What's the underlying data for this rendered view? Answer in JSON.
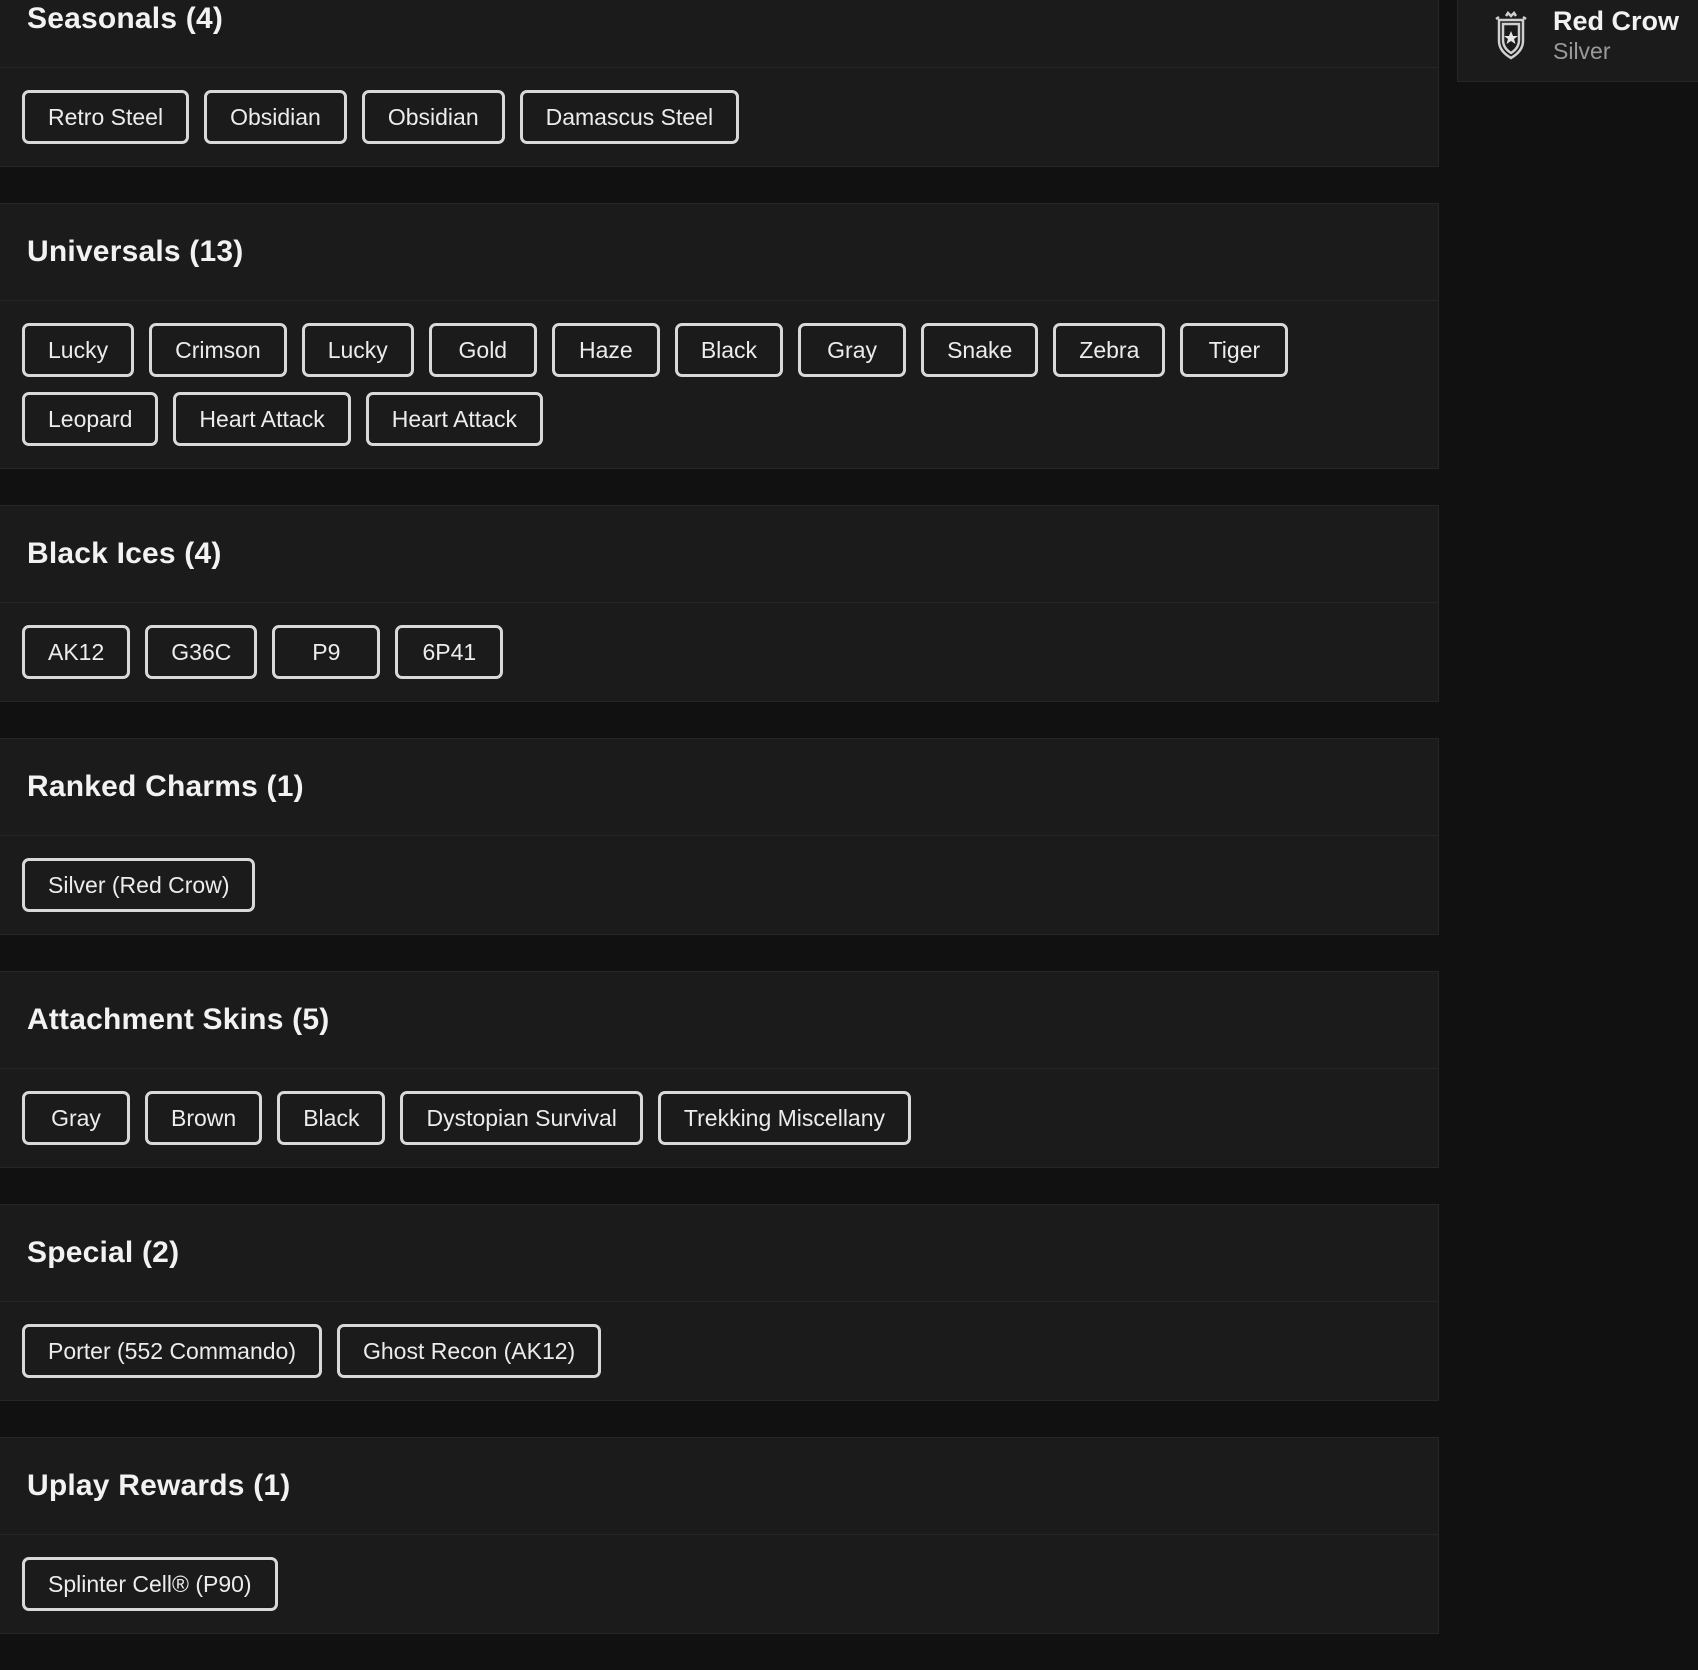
{
  "sections": [
    {
      "title": "Seasonals (4)",
      "items": [
        "Retro Steel",
        "Obsidian",
        "Obsidian",
        "Damascus Steel"
      ]
    },
    {
      "title": "Universals (13)",
      "items": [
        "Lucky",
        "Crimson",
        "Lucky",
        "Gold",
        "Haze",
        "Black",
        "Gray",
        "Snake",
        "Zebra",
        "Tiger",
        "Leopard",
        "Heart Attack",
        "Heart Attack"
      ]
    },
    {
      "title": "Black Ices (4)",
      "items": [
        "AK12",
        "G36C",
        "P9",
        "6P41"
      ]
    },
    {
      "title": "Ranked Charms (1)",
      "items": [
        "Silver (Red Crow)"
      ]
    },
    {
      "title": "Attachment Skins (5)",
      "items": [
        "Gray",
        "Brown",
        "Black",
        "Dystopian Survival",
        "Trekking Miscellany"
      ]
    },
    {
      "title": "Special (2)",
      "items": [
        "Porter (552 Commando)",
        "Ghost Recon (AK12)"
      ]
    },
    {
      "title": "Uplay Rewards (1)",
      "items": [
        "Splinter Cell® (P90)"
      ]
    }
  ],
  "rank": {
    "name": "Red Crow",
    "tier": "Silver",
    "icon": "rank-badge-icon"
  }
}
